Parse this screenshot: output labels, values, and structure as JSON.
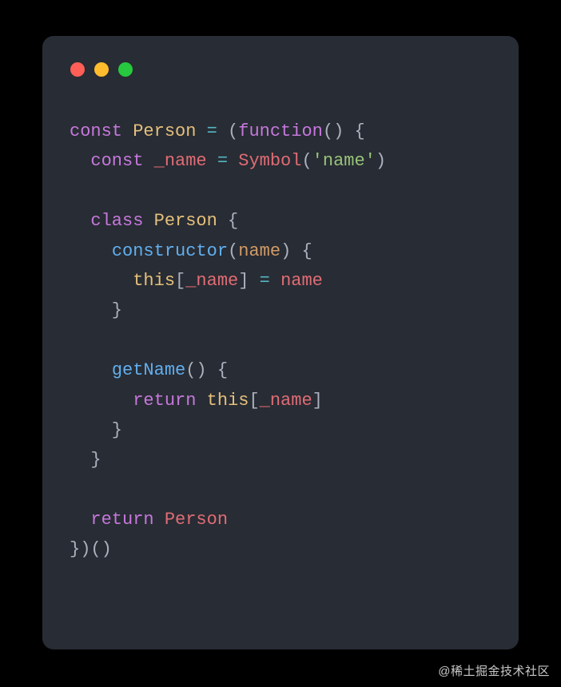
{
  "colors": {
    "background": "#000000",
    "card": "#282c34",
    "foreground": "#abb2bf",
    "keyword": "#c678dd",
    "class": "#e5c07b",
    "function": "#61afef",
    "symbol": "#e06c75",
    "operator": "#56b6c2",
    "string": "#98c379",
    "param": "#d19a66",
    "dot_red": "#ff5f56",
    "dot_yellow": "#ffbd2e",
    "dot_green": "#27c93f"
  },
  "code_lines": [
    [
      {
        "cls": "kw",
        "t": "const"
      },
      {
        "cls": "pn",
        "t": " "
      },
      {
        "cls": "cls",
        "t": "Person"
      },
      {
        "cls": "pn",
        "t": " "
      },
      {
        "cls": "eq",
        "t": "="
      },
      {
        "cls": "pn",
        "t": " ("
      },
      {
        "cls": "kw",
        "t": "function"
      },
      {
        "cls": "pn",
        "t": "() {"
      }
    ],
    [
      {
        "cls": "pn",
        "t": "  "
      },
      {
        "cls": "kw",
        "t": "const"
      },
      {
        "cls": "pn",
        "t": " "
      },
      {
        "cls": "sym",
        "t": "_name"
      },
      {
        "cls": "pn",
        "t": " "
      },
      {
        "cls": "eq",
        "t": "="
      },
      {
        "cls": "pn",
        "t": " "
      },
      {
        "cls": "sym",
        "t": "Symbol"
      },
      {
        "cls": "pn",
        "t": "("
      },
      {
        "cls": "str",
        "t": "'name'"
      },
      {
        "cls": "pn",
        "t": ")"
      }
    ],
    [],
    [
      {
        "cls": "pn",
        "t": "  "
      },
      {
        "cls": "kw",
        "t": "class"
      },
      {
        "cls": "pn",
        "t": " "
      },
      {
        "cls": "cls",
        "t": "Person"
      },
      {
        "cls": "pn",
        "t": " {"
      }
    ],
    [
      {
        "cls": "pn",
        "t": "    "
      },
      {
        "cls": "fn",
        "t": "constructor"
      },
      {
        "cls": "pn",
        "t": "("
      },
      {
        "cls": "par",
        "t": "name"
      },
      {
        "cls": "pn",
        "t": ") {"
      }
    ],
    [
      {
        "cls": "pn",
        "t": "      "
      },
      {
        "cls": "cls",
        "t": "this"
      },
      {
        "cls": "pn",
        "t": "["
      },
      {
        "cls": "sym",
        "t": "_name"
      },
      {
        "cls": "pn",
        "t": "] "
      },
      {
        "cls": "eq",
        "t": "="
      },
      {
        "cls": "pn",
        "t": " "
      },
      {
        "cls": "sym",
        "t": "name"
      }
    ],
    [
      {
        "cls": "pn",
        "t": "    }"
      }
    ],
    [],
    [
      {
        "cls": "pn",
        "t": "    "
      },
      {
        "cls": "fn",
        "t": "getName"
      },
      {
        "cls": "pn",
        "t": "() {"
      }
    ],
    [
      {
        "cls": "pn",
        "t": "      "
      },
      {
        "cls": "kw",
        "t": "return"
      },
      {
        "cls": "pn",
        "t": " "
      },
      {
        "cls": "cls",
        "t": "this"
      },
      {
        "cls": "pn",
        "t": "["
      },
      {
        "cls": "sym",
        "t": "_name"
      },
      {
        "cls": "pn",
        "t": "]"
      }
    ],
    [
      {
        "cls": "pn",
        "t": "    }"
      }
    ],
    [
      {
        "cls": "pn",
        "t": "  }"
      }
    ],
    [],
    [
      {
        "cls": "pn",
        "t": "  "
      },
      {
        "cls": "kw",
        "t": "return"
      },
      {
        "cls": "pn",
        "t": " "
      },
      {
        "cls": "sym",
        "t": "Person"
      }
    ],
    [
      {
        "cls": "pn",
        "t": "})()"
      }
    ]
  ],
  "watermark": "@稀土掘金技术社区"
}
